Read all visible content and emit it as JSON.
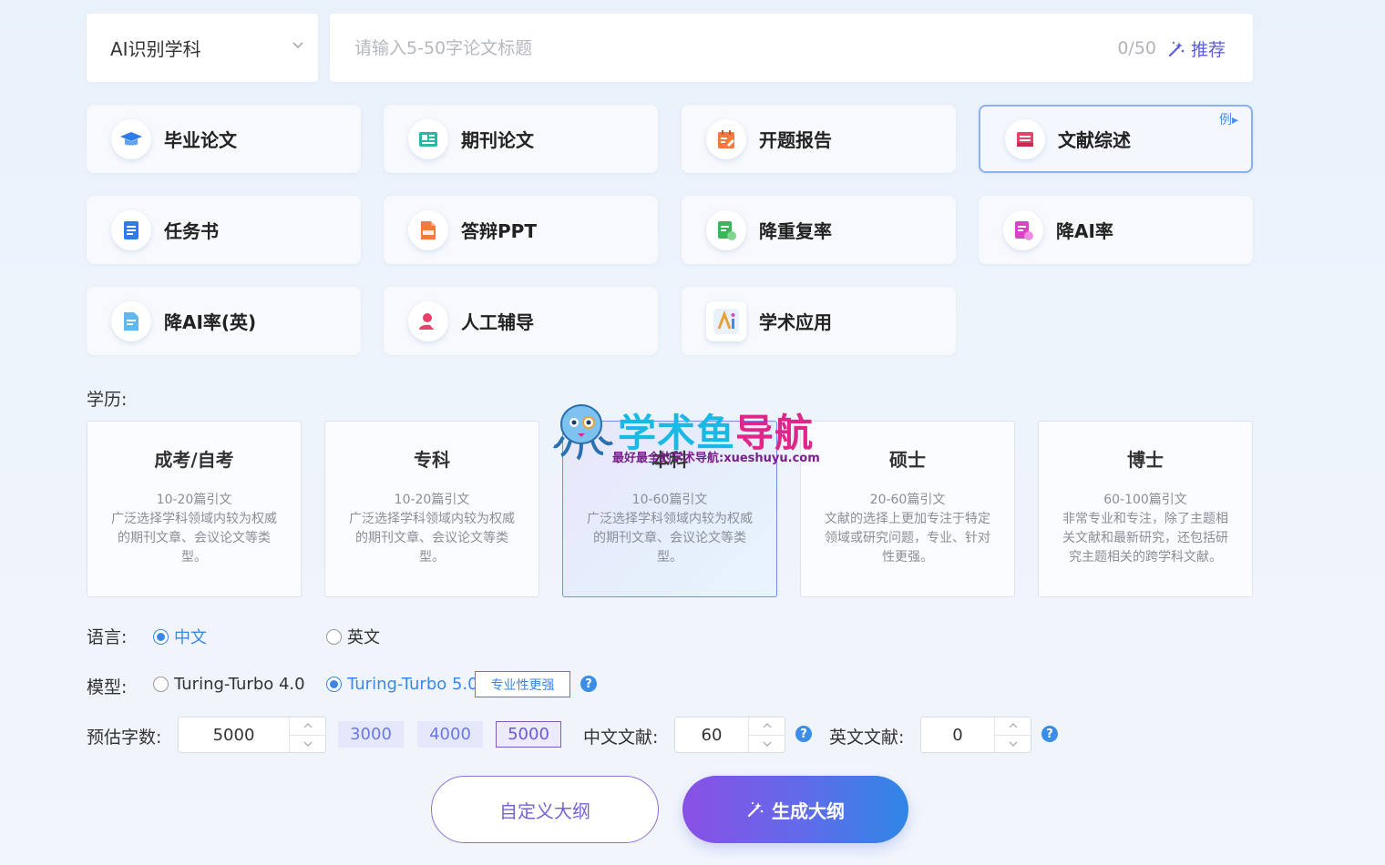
{
  "subject_select": {
    "value": "AI识别学科"
  },
  "title_input": {
    "placeholder": "请输入5-50字论文标题",
    "count": "0/50",
    "recommend": "推荐"
  },
  "features": [
    {
      "label": "毕业论文",
      "icon": "graduation-cap-icon",
      "color": "#2f7ce8"
    },
    {
      "label": "期刊论文",
      "icon": "journal-icon",
      "color": "#27b9a4"
    },
    {
      "label": "开题报告",
      "icon": "report-icon",
      "color": "#f07a40"
    },
    {
      "label": "文献综述",
      "icon": "literature-review-icon",
      "color": "#e8426a",
      "badge": "例"
    },
    {
      "label": "任务书",
      "icon": "task-book-icon",
      "color": "#2f7ce8"
    },
    {
      "label": "答辩PPT",
      "icon": "ppt-icon",
      "color": "#f07a40"
    },
    {
      "label": "降重复率",
      "icon": "reduce-duplicate-icon",
      "color": "#3bb55a"
    },
    {
      "label": "降AI率",
      "icon": "reduce-ai-icon",
      "color": "#d845c4"
    },
    {
      "label": "降AI率(英)",
      "icon": "reduce-ai-english-icon",
      "color": "#3a8ee8"
    },
    {
      "label": "人工辅导",
      "icon": "tutor-icon",
      "color": "#e8426a"
    },
    {
      "label": "学术应用",
      "icon": "academic-apps-icon",
      "color": "#e8a23a"
    }
  ],
  "education": {
    "label": "学历:",
    "options": [
      {
        "title": "成考/自考",
        "count": "10-20篇引文",
        "desc": "广泛选择学科领域内较为权威的期刊文章、会议论文等类型。"
      },
      {
        "title": "专科",
        "count": "10-20篇引文",
        "desc": "广泛选择学科领域内较为权威的期刊文章、会议论文等类型。"
      },
      {
        "title": "本科",
        "count": "10-60篇引文",
        "desc": "广泛选择学科领域内较为权威的期刊文章、会议论文等类型。"
      },
      {
        "title": "硕士",
        "count": "20-60篇引文",
        "desc": "文献的选择上更加专注于特定领域或研究问题，专业、针对性更强。"
      },
      {
        "title": "博士",
        "count": "60-100篇引文",
        "desc": "非常专业和专注，除了主题相关文献和最新研究，还包括研究主题相关的跨学科文献。"
      }
    ]
  },
  "language": {
    "label": "语言:",
    "options": [
      "中文",
      "英文"
    ],
    "selected": "中文"
  },
  "model": {
    "label": "模型:",
    "options": [
      "Turing-Turbo 4.0",
      "Turing-Turbo 5.0"
    ],
    "selected": "Turing-Turbo 5.0",
    "tag": "专业性更强"
  },
  "word_count": {
    "label": "预估字数:",
    "value": "5000",
    "presets": [
      "3000",
      "4000",
      "5000"
    ],
    "selected": "5000"
  },
  "cn_refs": {
    "label": "中文文献:",
    "value": "60"
  },
  "en_refs": {
    "label": "英文文献:",
    "value": "0"
  },
  "help_icon": "?",
  "buttons": {
    "custom_outline": "自定义大纲",
    "generate_outline": "生成大纲"
  },
  "watermark": {
    "title_a": "学术鱼",
    "title_b": "导航",
    "subtitle": "最好最全的学术导航:xueshuyu.com"
  }
}
